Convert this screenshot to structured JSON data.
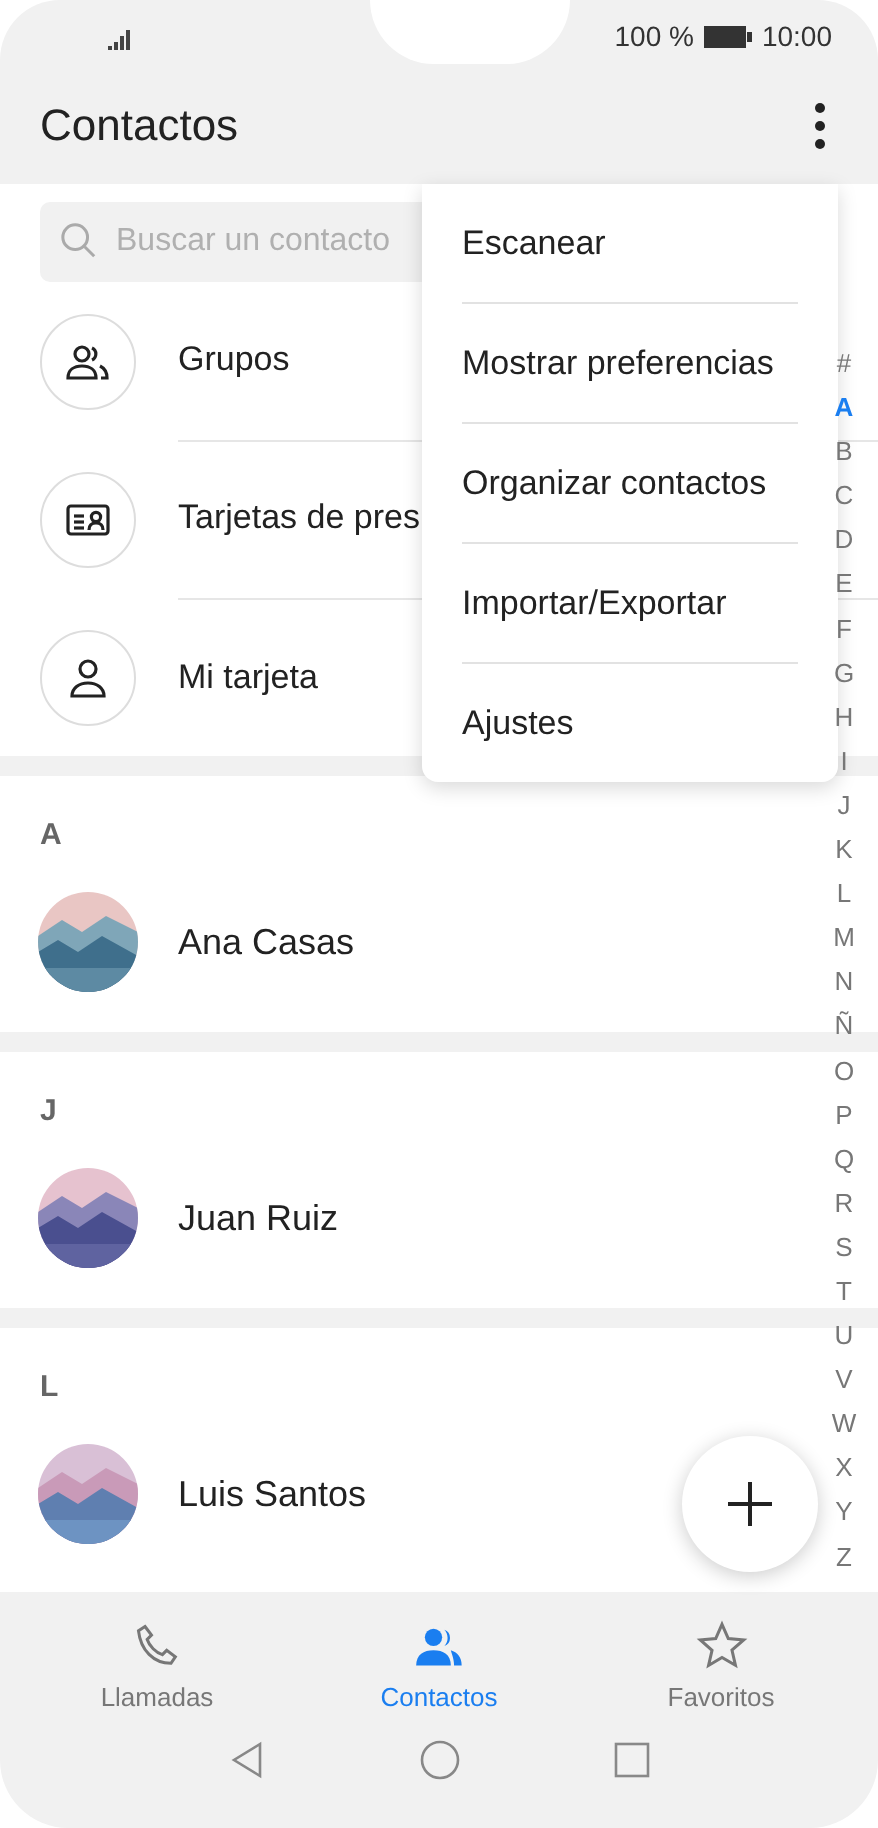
{
  "status_bar": {
    "battery": "100 %",
    "time": "10:00"
  },
  "header": {
    "title": "Contactos"
  },
  "search": {
    "placeholder": "Buscar un contacto"
  },
  "shortcuts": [
    {
      "kind": "groups",
      "label": "Grupos"
    },
    {
      "kind": "cards",
      "label": "Tarjetas de pres"
    },
    {
      "kind": "me",
      "label": "Mi tarjeta"
    }
  ],
  "sections": [
    {
      "letter": "A",
      "contacts": [
        {
          "name": "Ana Casas"
        }
      ]
    },
    {
      "letter": "J",
      "contacts": [
        {
          "name": "Juan Ruiz"
        }
      ]
    },
    {
      "letter": "L",
      "contacts": [
        {
          "name": "Luis Santos"
        }
      ]
    }
  ],
  "menu": [
    "Escanear",
    "Mostrar preferencias",
    "Organizar contactos",
    "Importar/Exportar",
    "Ajustes"
  ],
  "index": [
    {
      "label": "#",
      "selected": false
    },
    {
      "label": "A",
      "selected": true
    },
    {
      "label": "B",
      "selected": false
    },
    {
      "label": "C",
      "selected": false
    },
    {
      "label": "D",
      "selected": false
    },
    {
      "label": "E",
      "selected": false
    },
    {
      "label": "F",
      "selected": false
    },
    {
      "label": "G",
      "selected": false
    },
    {
      "label": "H",
      "selected": false
    },
    {
      "label": "I",
      "selected": false
    },
    {
      "label": "J",
      "selected": false
    },
    {
      "label": "K",
      "selected": false
    },
    {
      "label": "L",
      "selected": false
    },
    {
      "label": "M",
      "selected": false
    },
    {
      "label": "N",
      "selected": false
    },
    {
      "label": "Ñ",
      "selected": false
    },
    {
      "label": "O",
      "selected": false
    },
    {
      "label": "P",
      "selected": false
    },
    {
      "label": "Q",
      "selected": false
    },
    {
      "label": "R",
      "selected": false
    },
    {
      "label": "S",
      "selected": false
    },
    {
      "label": "T",
      "selected": false
    },
    {
      "label": "U",
      "selected": false
    },
    {
      "label": "V",
      "selected": false
    },
    {
      "label": "W",
      "selected": false
    },
    {
      "label": "X",
      "selected": false
    },
    {
      "label": "Y",
      "selected": false
    },
    {
      "label": "Z",
      "selected": false
    }
  ],
  "tabs": [
    {
      "kind": "calls",
      "label": "Llamadas",
      "selected": false
    },
    {
      "kind": "contacts",
      "label": "Contactos",
      "selected": true
    },
    {
      "kind": "favorites",
      "label": "Favoritos",
      "selected": false
    }
  ]
}
